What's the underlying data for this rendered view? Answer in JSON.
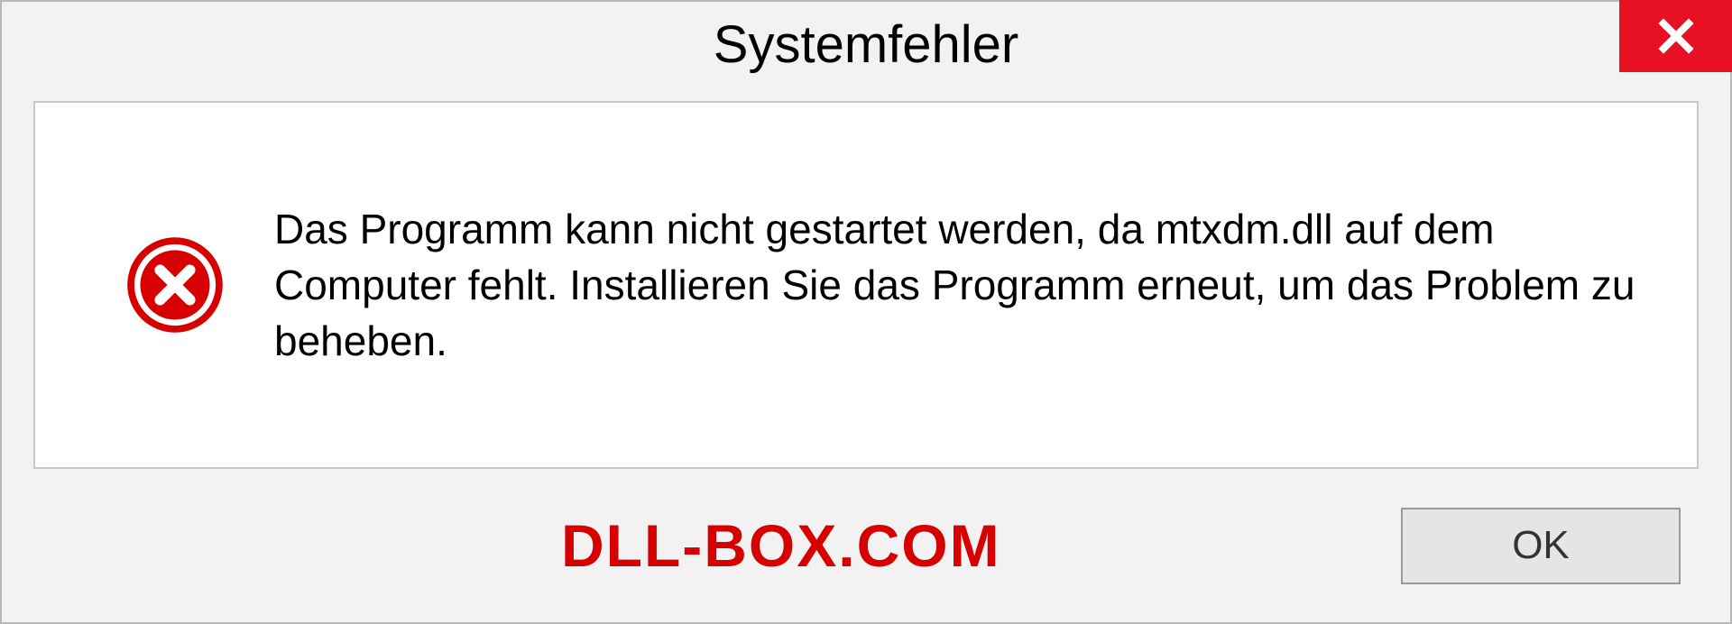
{
  "dialog": {
    "title": "Systemfehler",
    "message": "Das Programm kann nicht gestartet werden, da mtxdm.dll auf dem Computer fehlt. Installieren Sie das Programm erneut, um das Problem zu beheben.",
    "ok_label": "OK"
  },
  "watermark": "DLL-BOX.COM",
  "colors": {
    "close_bg": "#e81123",
    "watermark": "#d60000"
  },
  "icons": {
    "error": "error-circle-x",
    "close": "close-x"
  }
}
